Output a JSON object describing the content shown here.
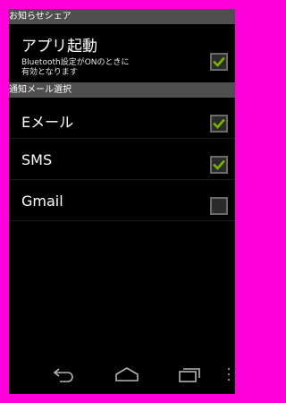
{
  "sections": {
    "notify": {
      "title": "お知らせシェア"
    },
    "mail": {
      "title": "通知メール選択"
    }
  },
  "app_launch": {
    "label": "アプリ起動",
    "sub1": "Bluetooth設定がONのときに",
    "sub2": "有効となります",
    "checked": true
  },
  "mail_items": [
    {
      "label": "Eメール",
      "checked": true
    },
    {
      "label": "SMS",
      "checked": true
    },
    {
      "label": "Gmail",
      "checked": false
    }
  ],
  "colors": {
    "frame": "#ff00d8",
    "check": "#7ab800",
    "header": "#4f4f4f"
  },
  "nav": {
    "back_icon": "back-icon",
    "home_icon": "home-icon",
    "recent_icon": "recent-apps-icon",
    "menu_icon": "overflow-menu-icon"
  }
}
